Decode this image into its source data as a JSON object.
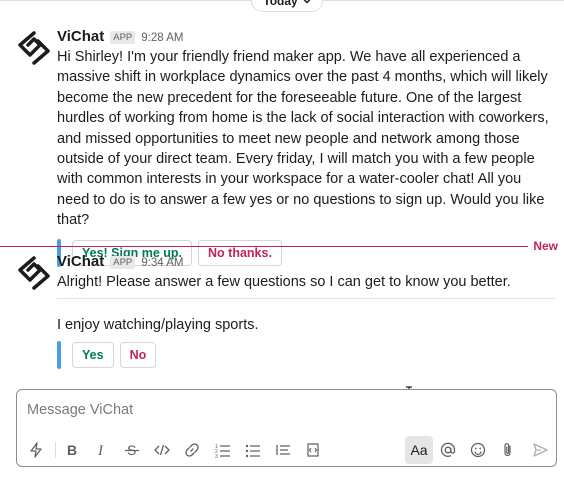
{
  "date_divider": {
    "label": "Today"
  },
  "messages": [
    {
      "sender": "ViChat",
      "badge": "APP",
      "time": "9:28 AM",
      "text": "Hi Shirley! I'm your friendly friend maker app. We have all experienced a massive shift in workplace dynamics over the past 4 months, which will likely become the new precedent for the foreseeable future. One of the largest hurdles of working from home is the lack of social interaction with coworkers, and missed opportunities to meet new people and network among those outside of your direct team. Every friday, I will match you with a few people with common interests in your workspace for a water-cooler chat! All you need to do is to answer a few yes or no questions to sign up. Would you like that?",
      "buttons": [
        "Yes! Sign me up.",
        "No thanks."
      ]
    },
    {
      "sender": "ViChat",
      "badge": "APP",
      "time": "9:34 AM",
      "text": "Alright! Please answer a few questions so I can get to know you better.",
      "question": "I enjoy watching/playing sports.",
      "buttons": [
        "Yes",
        "No"
      ]
    }
  ],
  "new_divider": {
    "label": "New"
  },
  "composer": {
    "placeholder": "Message ViChat",
    "toolbar": [
      "shortcuts-icon",
      "bold-icon",
      "italic-icon",
      "strikethrough-icon",
      "code-icon",
      "link-icon",
      "ordered-list-icon",
      "bulleted-list-icon",
      "blockquote-icon",
      "code-block-icon",
      "formatting-toggle",
      "mention-icon",
      "emoji-icon",
      "attachment-icon",
      "send-icon"
    ],
    "format_label": "Aa"
  },
  "colors": {
    "accent_green": "#007a5a",
    "accent_red": "#c0245c",
    "new_line": "#c0245c",
    "attachment_bar": "#4a9fe0"
  }
}
